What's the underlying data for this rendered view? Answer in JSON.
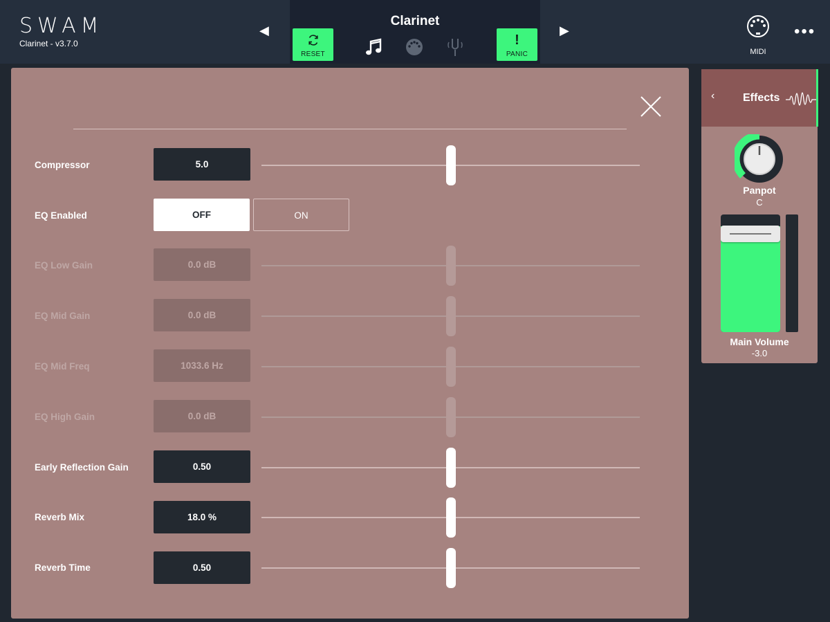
{
  "header": {
    "logo": "SWAM",
    "version": "Clarinet - v3.7.0",
    "instrument": "Clarinet",
    "reset_label": "RESET",
    "panic_label": "PANIC",
    "panic_glyph": "!",
    "midi_label": "MIDI",
    "more_glyph": "•••",
    "prev_glyph": "◀",
    "next_glyph": "▶",
    "accent_color": "#3df57d"
  },
  "effects_panel": {
    "rows": [
      {
        "label": "Compressor",
        "value": "5.0",
        "slider_position": 0.5,
        "enabled": true
      },
      {
        "label": "EQ Enabled",
        "toggle_options": [
          "OFF",
          "ON"
        ],
        "selected": "OFF"
      },
      {
        "label": "EQ Low Gain",
        "value": "0.0 dB",
        "slider_position": 0.5,
        "enabled": false
      },
      {
        "label": "EQ Mid Gain",
        "value": "0.0 dB",
        "slider_position": 0.5,
        "enabled": false
      },
      {
        "label": "EQ Mid Freq",
        "value": "1033.6 Hz",
        "slider_position": 0.5,
        "enabled": false
      },
      {
        "label": "EQ High Gain",
        "value": "0.0 dB",
        "slider_position": 0.5,
        "enabled": false
      },
      {
        "label": "Early Reflection Gain",
        "value": "0.50",
        "slider_position": 0.5,
        "enabled": true
      },
      {
        "label": "Reverb Mix",
        "value": "18.0 %",
        "slider_position": 0.5,
        "enabled": true
      },
      {
        "label": "Reverb Time",
        "value": "0.50",
        "slider_position": 0.5,
        "enabled": true
      }
    ]
  },
  "side_strip": {
    "back_glyph": "‹",
    "title": "Effects",
    "panpot_label": "Panpot",
    "panpot_value": "C",
    "volume_label": "Main Volume",
    "volume_value": "-3.0",
    "volume_level": 0.9
  }
}
